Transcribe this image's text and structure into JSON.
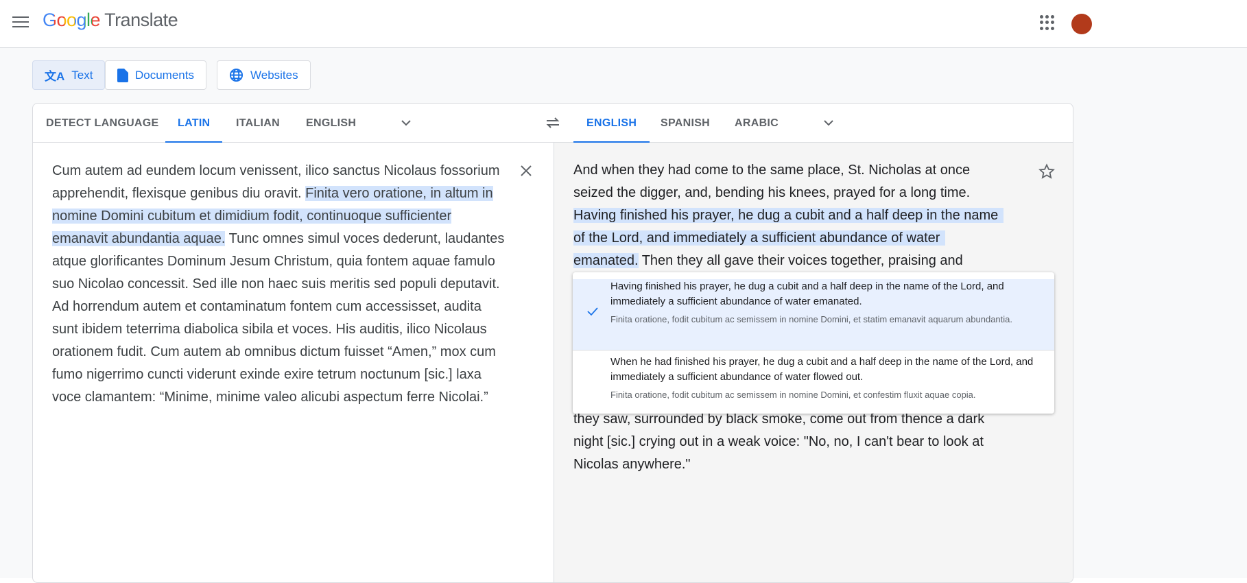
{
  "header": {
    "logo_google": "Google",
    "logo_product": "Translate"
  },
  "modes": [
    {
      "label": "Text",
      "icon": "translate-icon"
    },
    {
      "label": "Documents",
      "icon": "document-icon"
    },
    {
      "label": "Websites",
      "icon": "globe-icon"
    }
  ],
  "source_langs": [
    "DETECT LANGUAGE",
    "LATIN",
    "ITALIAN",
    "ENGLISH"
  ],
  "target_langs": [
    "ENGLISH",
    "SPANISH",
    "ARABIC"
  ],
  "source": {
    "before": "Cum autem ad eundem locum venissent, ilico sanctus Nicolaus fossorium apprehendit, flexisque genibus diu oravit. ",
    "highlight": "Finita vero oratione, in altum in nomine Domini cubitum et dimidium fodit, continuoque sufficienter emanavit abundantia aquae.",
    "after": " Tunc omnes simul voces dederunt, laudantes atque glorificantes Dominum Jesum Christum, quia fontem aquae famulo suo Nicolao concessit. Sed ille non haec suis meritis sed populi deputavit. Ad horrendum autem et contaminatum fontem cum accessisset, audita sunt ibidem teterrima diabolica sibila et voces. His auditis, ilico Nicolaus orationem fudit. Cum autem ab omnibus dictum fuisset “Amen,” mox cum fumo nigerrimo  cuncti viderunt exinde exire tetrum noctunum [sic.] laxa voce clamantem: “Minime, minime valeo alicubi aspectum ferre Nicolai.”"
  },
  "target": {
    "line1": "And when they had come to the same place, St. Nicholas at once",
    "line2": "seized the digger, and, bending his knees, prayed for a long time.",
    "line3": "Having finished his prayer, he dug a cubit and a half deep in the name",
    "line4": "of the Lord, and immediately a sufficient abundance of water",
    "line5_hl": "emanated.",
    "line5_rest": " Then they all gave their voices together, praising and",
    "line6": "they saw, surrounded by black smoke, come out from thence a dark",
    "line7": "night [sic.] crying out in a weak voice: \"No, no, I can't bear to look at",
    "line8": "Nicolas anywhere.\""
  },
  "alternatives": [
    {
      "translation": "Having finished his prayer, he dug a cubit and a half deep in the name of the Lord, and immediately a sufficient abundance of water emanated.",
      "source": "Finita oratione, fodit cubitum ac semissem in nomine Domini, et statim emanavit aquarum abundantia.",
      "selected": true
    },
    {
      "translation": "When he had finished his prayer, he dug a cubit and a half deep in the name of the Lord, and immediately a sufficient abundance of water flowed out.",
      "source": "Finita oratione, fodit cubitum ac semissem in nomine Domini, et confestim fluxit aquae copia.",
      "selected": false
    }
  ],
  "colors": {
    "accent": "#1a73e8",
    "highlight": "#d2e3fc"
  }
}
